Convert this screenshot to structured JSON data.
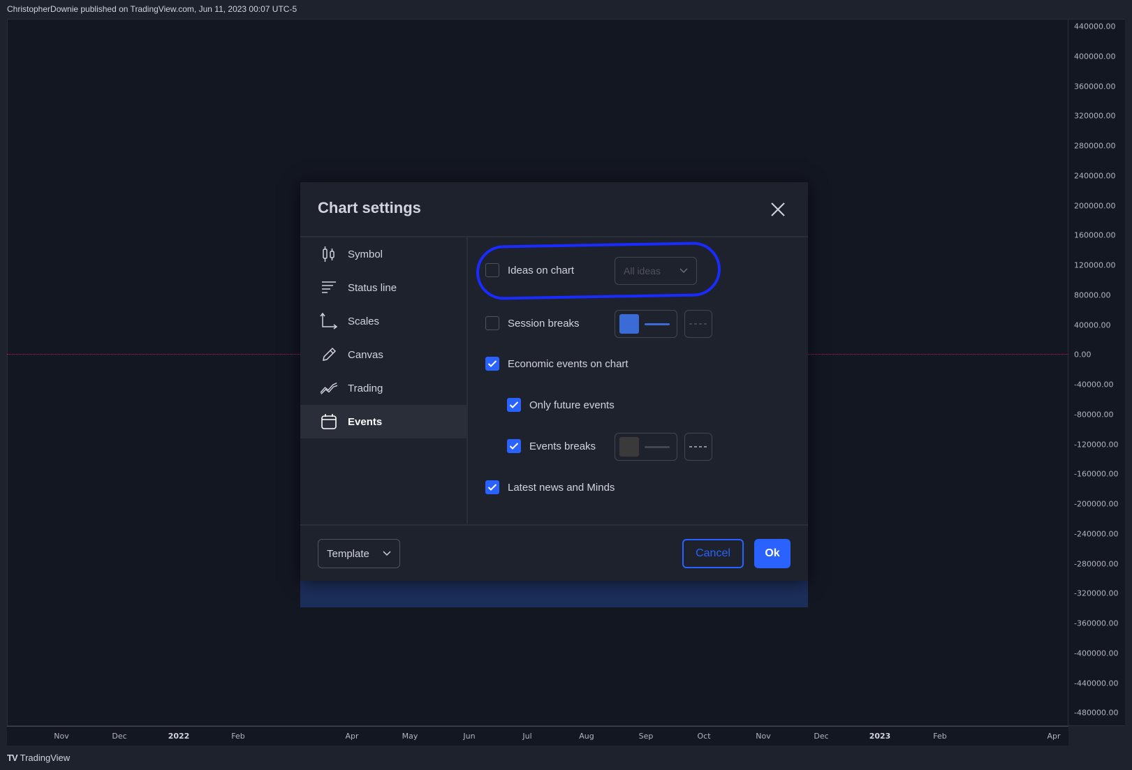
{
  "header": {
    "publish_info": "ChristopherDownie published on TradingView.com, Jun 11, 2023 00:07 UTC-5"
  },
  "price_axis": {
    "labels": [
      "440000.00",
      "400000.00",
      "360000.00",
      "320000.00",
      "280000.00",
      "240000.00",
      "200000.00",
      "160000.00",
      "120000.00",
      "80000.00",
      "40000.00",
      "0.00",
      "-40000.00",
      "-80000.00",
      "-120000.00",
      "-160000.00",
      "-200000.00",
      "-240000.00",
      "-280000.00",
      "-320000.00",
      "-360000.00",
      "-400000.00",
      "-440000.00",
      "-480000.00"
    ]
  },
  "time_axis": {
    "labels": [
      "Nov",
      "Dec",
      "2022",
      "Feb",
      "Apr",
      "May",
      "Jun",
      "Jul",
      "Aug",
      "Sep",
      "Oct",
      "Nov",
      "Dec",
      "2023",
      "Feb",
      "Apr"
    ]
  },
  "footer": {
    "brand_logo": "TV",
    "brand": "TradingView"
  },
  "dialog": {
    "title": "Chart settings",
    "nav": [
      {
        "label": "Symbol",
        "icon": "candles-icon"
      },
      {
        "label": "Status line",
        "icon": "status-line-icon"
      },
      {
        "label": "Scales",
        "icon": "scales-icon"
      },
      {
        "label": "Canvas",
        "icon": "pencil-icon"
      },
      {
        "label": "Trading",
        "icon": "trading-icon"
      },
      {
        "label": "Events",
        "icon": "calendar-icon",
        "active": true
      }
    ],
    "options": {
      "ideas_on_chart": {
        "label": "Ideas on chart",
        "checked": false,
        "select_value": "All ideas"
      },
      "session_breaks": {
        "label": "Session breaks",
        "checked": false,
        "color": "#3b6bd6"
      },
      "economic_events": {
        "label": "Economic events on chart",
        "checked": true
      },
      "only_future_events": {
        "label": "Only future events",
        "checked": true
      },
      "events_breaks": {
        "label": "Events breaks",
        "checked": true,
        "color": "#4a4a4a"
      },
      "latest_news": {
        "label": "Latest news and Minds",
        "checked": true
      }
    },
    "footer": {
      "template_label": "Template",
      "cancel_label": "Cancel",
      "ok_label": "Ok"
    }
  },
  "colors": {
    "accent": "#2962ff",
    "annotation": "#1a2bff",
    "zero_line": "#c2185b",
    "background": "#131722"
  }
}
